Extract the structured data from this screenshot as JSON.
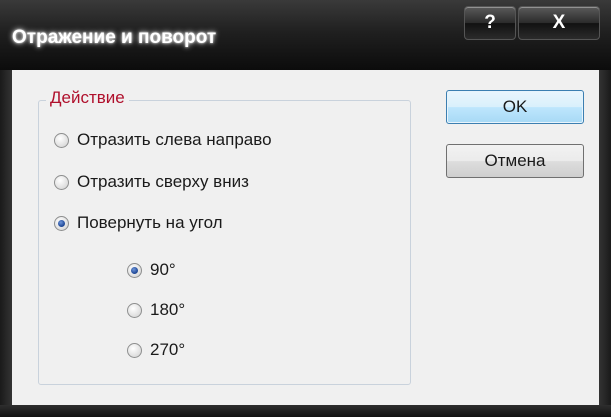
{
  "window": {
    "title": "Отражение и поворот",
    "help_label": "?",
    "close_label": "X"
  },
  "group": {
    "legend": "Действие",
    "options": [
      {
        "label": "Отразить слева направо",
        "checked": false
      },
      {
        "label": "Отразить сверху вниз",
        "checked": false
      },
      {
        "label": "Повернуть на угол",
        "checked": true
      }
    ],
    "angles": [
      {
        "label": "90°",
        "checked": true
      },
      {
        "label": "180°",
        "checked": false
      },
      {
        "label": "270°",
        "checked": false
      }
    ]
  },
  "buttons": {
    "ok_label": "OK",
    "cancel_label": "Отмена"
  }
}
